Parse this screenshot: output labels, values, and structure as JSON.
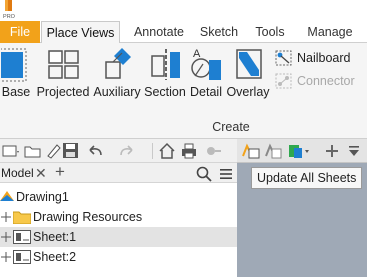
{
  "ribbon_tabs": [
    {
      "label": "File"
    },
    {
      "label": "Place Views"
    },
    {
      "label": "Annotate"
    },
    {
      "label": "Sketch"
    },
    {
      "label": "Tools"
    },
    {
      "label": "Manage"
    }
  ],
  "logo_text": "PRO",
  "create_group": {
    "label": "Create",
    "buttons": [
      {
        "label": "Base",
        "icon": "base-view-icon"
      },
      {
        "label": "Projected",
        "icon": "projected-view-icon"
      },
      {
        "label": "Auxiliary",
        "icon": "auxiliary-view-icon"
      },
      {
        "label": "Section",
        "icon": "section-view-icon"
      },
      {
        "label": "Detail",
        "icon": "detail-view-icon"
      },
      {
        "label": "Overlay",
        "icon": "overlay-view-icon"
      }
    ],
    "small_buttons": [
      {
        "label": "Nailboard",
        "enabled": true
      },
      {
        "label": "Connector",
        "enabled": false
      }
    ]
  },
  "browser": {
    "tab_label": "Model",
    "close_glyph": "✕",
    "add_glyph": "+",
    "tree": [
      {
        "label": "Drawing1"
      },
      {
        "label": "Drawing Resources"
      },
      {
        "label": "Sheet:1"
      },
      {
        "label": "Sheet:2"
      }
    ]
  },
  "tooltip": "Update All Sheets",
  "colors": {
    "file_tab": "#f2a21a",
    "accent_blue": "#1e7fd1",
    "canvas_bg": "#9fa9b6"
  }
}
